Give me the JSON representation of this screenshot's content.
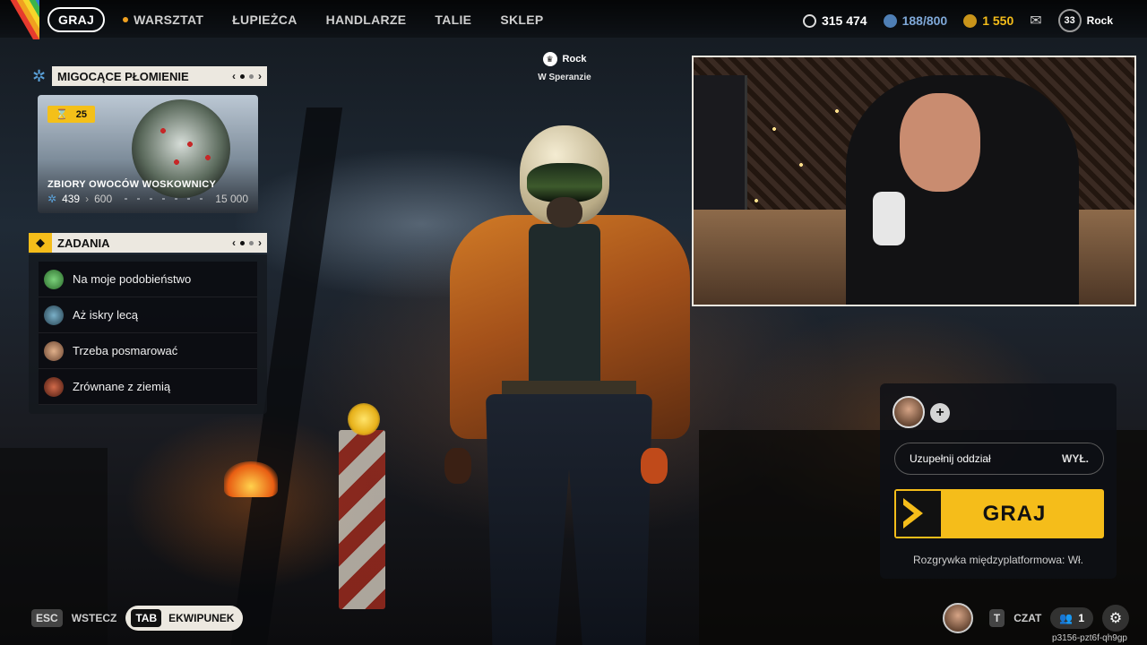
{
  "nav": {
    "items": [
      {
        "label": "GRAJ",
        "active": true
      },
      {
        "label": "WARSZTAT",
        "active": false
      },
      {
        "label": "ŁUPIEŻCA",
        "active": false
      },
      {
        "label": "HANDLARZE",
        "active": false
      },
      {
        "label": "TALIE",
        "active": false
      },
      {
        "label": "SKLEP",
        "active": false
      }
    ]
  },
  "currencies": {
    "coins": "315 474",
    "tokens": "188/800",
    "gold": "1 550",
    "level": "33",
    "username": "Rock"
  },
  "event": {
    "title": "MIGOCĄCE PŁOMIENIE",
    "badge": "25",
    "card_name": "ZBIORY OWOCÓW WOSKOWNICY",
    "progress_current": "439",
    "progress_next": "600",
    "progress_max": "15 000"
  },
  "tasks": {
    "title": "ZADANIA",
    "items": [
      {
        "label": "Na moje podobieństwo"
      },
      {
        "label": "Aż iskry lecą"
      },
      {
        "label": "Trzeba posmarować"
      },
      {
        "label": "Zrównane z ziemią"
      }
    ]
  },
  "player": {
    "name": "Rock",
    "location": "W Speranzie"
  },
  "lobby": {
    "fill_squad_label": "Uzupełnij oddział",
    "fill_squad_state": "WYŁ.",
    "play_label": "GRAJ",
    "crossplay": "Rozgrywka międzyplatformowa: Wł."
  },
  "bottom": {
    "esc_key": "ESC",
    "back_label": "WSTECZ",
    "tab_key": "TAB",
    "inventory_label": "EKWIPUNEK",
    "chat_key": "T",
    "chat_label": "CZAT",
    "friends_count": "1",
    "session_id": "p3156-pzt6f-qh9gp"
  },
  "colors": {
    "accent": "#f5bd1a",
    "panel_header": "#ece8e0"
  }
}
